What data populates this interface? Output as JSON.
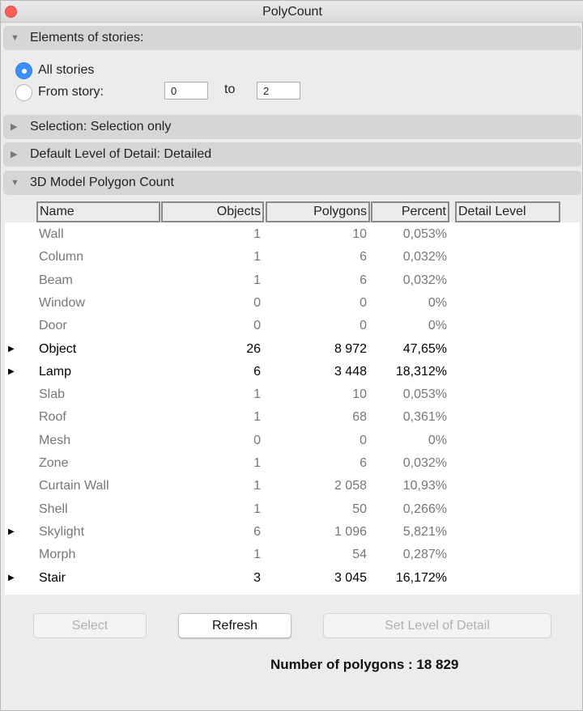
{
  "window": {
    "title": "PolyCount"
  },
  "sections": {
    "elements": "Elements of stories:",
    "selection": "Selection: Selection only",
    "lod": "Default Level of Detail: Detailed",
    "polycount": "3D Model Polygon Count"
  },
  "stories": {
    "all_label": "All stories",
    "from_label": "From story:",
    "to_label": "to",
    "from_value": "0",
    "to_value": "2",
    "selected": "All stories"
  },
  "table": {
    "headers": [
      "Name",
      "Objects",
      "Polygons",
      "Percent",
      "Detail Level"
    ],
    "rows": [
      {
        "name": "Wall",
        "objects": "1",
        "polygons": "10",
        "percent": "0,053%",
        "expandable": false,
        "bold": false
      },
      {
        "name": "Column",
        "objects": "1",
        "polygons": "6",
        "percent": "0,032%",
        "expandable": false,
        "bold": false
      },
      {
        "name": "Beam",
        "objects": "1",
        "polygons": "6",
        "percent": "0,032%",
        "expandable": false,
        "bold": false
      },
      {
        "name": "Window",
        "objects": "0",
        "polygons": "0",
        "percent": "0%",
        "expandable": false,
        "bold": false
      },
      {
        "name": "Door",
        "objects": "0",
        "polygons": "0",
        "percent": "0%",
        "expandable": false,
        "bold": false
      },
      {
        "name": "Object",
        "objects": "26",
        "polygons": "8 972",
        "percent": "47,65%",
        "expandable": true,
        "bold": true
      },
      {
        "name": "Lamp",
        "objects": "6",
        "polygons": "3 448",
        "percent": "18,312%",
        "expandable": true,
        "bold": true
      },
      {
        "name": "Slab",
        "objects": "1",
        "polygons": "10",
        "percent": "0,053%",
        "expandable": false,
        "bold": false
      },
      {
        "name": "Roof",
        "objects": "1",
        "polygons": "68",
        "percent": "0,361%",
        "expandable": false,
        "bold": false
      },
      {
        "name": "Mesh",
        "objects": "0",
        "polygons": "0",
        "percent": "0%",
        "expandable": false,
        "bold": false
      },
      {
        "name": "Zone",
        "objects": "1",
        "polygons": "6",
        "percent": "0,032%",
        "expandable": false,
        "bold": false
      },
      {
        "name": "Curtain Wall",
        "objects": "1",
        "polygons": "2 058",
        "percent": "10,93%",
        "expandable": false,
        "bold": false
      },
      {
        "name": "Shell",
        "objects": "1",
        "polygons": "50",
        "percent": "0,266%",
        "expandable": false,
        "bold": false
      },
      {
        "name": "Skylight",
        "objects": "6",
        "polygons": "1 096",
        "percent": "5,821%",
        "expandable": true,
        "bold": false
      },
      {
        "name": "Morph",
        "objects": "1",
        "polygons": "54",
        "percent": "0,287%",
        "expandable": false,
        "bold": false
      },
      {
        "name": "Stair",
        "objects": "3",
        "polygons": "3 045",
        "percent": "16,172%",
        "expandable": true,
        "bold": true
      }
    ]
  },
  "buttons": {
    "select": "Select",
    "refresh": "Refresh",
    "set_lod": "Set Level of Detail"
  },
  "total": "Number of polygons : 18 829",
  "colors": {
    "accent": "#3d8ef7",
    "close": "#fc5f57"
  }
}
